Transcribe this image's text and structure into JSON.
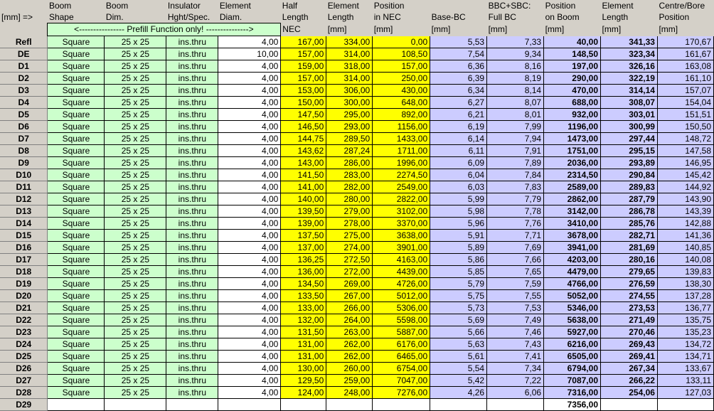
{
  "header": {
    "corner": "[mm] =>",
    "cols": [
      [
        "Boom",
        "Shape",
        ""
      ],
      [
        "Boom",
        "Dim.",
        ""
      ],
      [
        "Insulator",
        "Hght/Spec.",
        ""
      ],
      [
        "Element",
        "Diam.",
        ""
      ],
      [
        "Half",
        "Length",
        "NEC"
      ],
      [
        "Element",
        "Length",
        "[mm]"
      ],
      [
        "Position",
        "in NEC",
        "[mm]"
      ],
      [
        "",
        "Base-BC",
        "[mm]"
      ],
      [
        "BBC+SBC:",
        "Full BC",
        "[mm]"
      ],
      [
        "Position",
        "on Boom",
        "[mm]"
      ],
      [
        "Element",
        "Length",
        "[mm]"
      ],
      [
        "Centre/Bore",
        "Position",
        "[mm]"
      ]
    ],
    "prefill": "<---------------- Prefill Function only! --------------->"
  },
  "rows": [
    [
      "Refl",
      "Square",
      "25 x 25",
      "ins.thru",
      "4,00",
      "167,00",
      "334,00",
      "0,00",
      "5,53",
      "7,33",
      "40,00",
      "341,33",
      "170,67"
    ],
    [
      "DE",
      "Square",
      "25 x 25",
      "ins.thru",
      "10,00",
      "157,00",
      "314,00",
      "108,50",
      "7,54",
      "9,34",
      "148,50",
      "323,34",
      "161,67"
    ],
    [
      "D1",
      "Square",
      "25 x 25",
      "ins.thru",
      "4,00",
      "159,00",
      "318,00",
      "157,00",
      "6,36",
      "8,16",
      "197,00",
      "326,16",
      "163,08"
    ],
    [
      "D2",
      "Square",
      "25 x 25",
      "ins.thru",
      "4,00",
      "157,00",
      "314,00",
      "250,00",
      "6,39",
      "8,19",
      "290,00",
      "322,19",
      "161,10"
    ],
    [
      "D3",
      "Square",
      "25 x 25",
      "ins.thru",
      "4,00",
      "153,00",
      "306,00",
      "430,00",
      "6,34",
      "8,14",
      "470,00",
      "314,14",
      "157,07"
    ],
    [
      "D4",
      "Square",
      "25 x 25",
      "ins.thru",
      "4,00",
      "150,00",
      "300,00",
      "648,00",
      "6,27",
      "8,07",
      "688,00",
      "308,07",
      "154,04"
    ],
    [
      "D5",
      "Square",
      "25 x 25",
      "ins.thru",
      "4,00",
      "147,50",
      "295,00",
      "892,00",
      "6,21",
      "8,01",
      "932,00",
      "303,01",
      "151,51"
    ],
    [
      "D6",
      "Square",
      "25 x 25",
      "ins.thru",
      "4,00",
      "146,50",
      "293,00",
      "1156,00",
      "6,19",
      "7,99",
      "1196,00",
      "300,99",
      "150,50"
    ],
    [
      "D7",
      "Square",
      "25 x 25",
      "ins.thru",
      "4,00",
      "144,75",
      "289,50",
      "1433,00",
      "6,14",
      "7,94",
      "1473,00",
      "297,44",
      "148,72"
    ],
    [
      "D8",
      "Square",
      "25 x 25",
      "ins.thru",
      "4,00",
      "143,62",
      "287,24",
      "1711,00",
      "6,11",
      "7,91",
      "1751,00",
      "295,15",
      "147,58"
    ],
    [
      "D9",
      "Square",
      "25 x 25",
      "ins.thru",
      "4,00",
      "143,00",
      "286,00",
      "1996,00",
      "6,09",
      "7,89",
      "2036,00",
      "293,89",
      "146,95"
    ],
    [
      "D10",
      "Square",
      "25 x 25",
      "ins.thru",
      "4,00",
      "141,50",
      "283,00",
      "2274,50",
      "6,04",
      "7,84",
      "2314,50",
      "290,84",
      "145,42"
    ],
    [
      "D11",
      "Square",
      "25 x 25",
      "ins.thru",
      "4,00",
      "141,00",
      "282,00",
      "2549,00",
      "6,03",
      "7,83",
      "2589,00",
      "289,83",
      "144,92"
    ],
    [
      "D12",
      "Square",
      "25 x 25",
      "ins.thru",
      "4,00",
      "140,00",
      "280,00",
      "2822,00",
      "5,99",
      "7,79",
      "2862,00",
      "287,79",
      "143,90"
    ],
    [
      "D13",
      "Square",
      "25 x 25",
      "ins.thru",
      "4,00",
      "139,50",
      "279,00",
      "3102,00",
      "5,98",
      "7,78",
      "3142,00",
      "286,78",
      "143,39"
    ],
    [
      "D14",
      "Square",
      "25 x 25",
      "ins.thru",
      "4,00",
      "139,00",
      "278,00",
      "3370,00",
      "5,96",
      "7,76",
      "3410,00",
      "285,76",
      "142,88"
    ],
    [
      "D15",
      "Square",
      "25 x 25",
      "ins.thru",
      "4,00",
      "137,50",
      "275,00",
      "3638,00",
      "5,91",
      "7,71",
      "3678,00",
      "282,71",
      "141,36"
    ],
    [
      "D16",
      "Square",
      "25 x 25",
      "ins.thru",
      "4,00",
      "137,00",
      "274,00",
      "3901,00",
      "5,89",
      "7,69",
      "3941,00",
      "281,69",
      "140,85"
    ],
    [
      "D17",
      "Square",
      "25 x 25",
      "ins.thru",
      "4,00",
      "136,25",
      "272,50",
      "4163,00",
      "5,86",
      "7,66",
      "4203,00",
      "280,16",
      "140,08"
    ],
    [
      "D18",
      "Square",
      "25 x 25",
      "ins.thru",
      "4,00",
      "136,00",
      "272,00",
      "4439,00",
      "5,85",
      "7,65",
      "4479,00",
      "279,65",
      "139,83"
    ],
    [
      "D19",
      "Square",
      "25 x 25",
      "ins.thru",
      "4,00",
      "134,50",
      "269,00",
      "4726,00",
      "5,79",
      "7,59",
      "4766,00",
      "276,59",
      "138,30"
    ],
    [
      "D20",
      "Square",
      "25 x 25",
      "ins.thru",
      "4,00",
      "133,50",
      "267,00",
      "5012,00",
      "5,75",
      "7,55",
      "5052,00",
      "274,55",
      "137,28"
    ],
    [
      "D21",
      "Square",
      "25 x 25",
      "ins.thru",
      "4,00",
      "133,00",
      "266,00",
      "5306,00",
      "5,73",
      "7,53",
      "5346,00",
      "273,53",
      "136,77"
    ],
    [
      "D22",
      "Square",
      "25 x 25",
      "ins.thru",
      "4,00",
      "132,00",
      "264,00",
      "5598,00",
      "5,69",
      "7,49",
      "5638,00",
      "271,49",
      "135,75"
    ],
    [
      "D23",
      "Square",
      "25 x 25",
      "ins.thru",
      "4,00",
      "131,50",
      "263,00",
      "5887,00",
      "5,66",
      "7,46",
      "5927,00",
      "270,46",
      "135,23"
    ],
    [
      "D24",
      "Square",
      "25 x 25",
      "ins.thru",
      "4,00",
      "131,00",
      "262,00",
      "6176,00",
      "5,63",
      "7,43",
      "6216,00",
      "269,43",
      "134,72"
    ],
    [
      "D25",
      "Square",
      "25 x 25",
      "ins.thru",
      "4,00",
      "131,00",
      "262,00",
      "6465,00",
      "5,61",
      "7,41",
      "6505,00",
      "269,41",
      "134,71"
    ],
    [
      "D26",
      "Square",
      "25 x 25",
      "ins.thru",
      "4,00",
      "130,00",
      "260,00",
      "6754,00",
      "5,54",
      "7,34",
      "6794,00",
      "267,34",
      "133,67"
    ],
    [
      "D27",
      "Square",
      "25 x 25",
      "ins.thru",
      "4,00",
      "129,50",
      "259,00",
      "7047,00",
      "5,42",
      "7,22",
      "7087,00",
      "266,22",
      "133,11"
    ],
    [
      "D28",
      "Square",
      "25 x 25",
      "ins.thru",
      "4,00",
      "124,00",
      "248,00",
      "7276,00",
      "4,26",
      "6,06",
      "7316,00",
      "254,06",
      "127,03"
    ]
  ],
  "last_row": {
    "label": "D29",
    "position_on_boom": "7356,00"
  },
  "colors": {
    "prefill_green": "#ccffcc",
    "nec_yellow": "#ffff00",
    "calc_lavender": "#ccccff",
    "sheet_gray": "#d4d0c8"
  }
}
